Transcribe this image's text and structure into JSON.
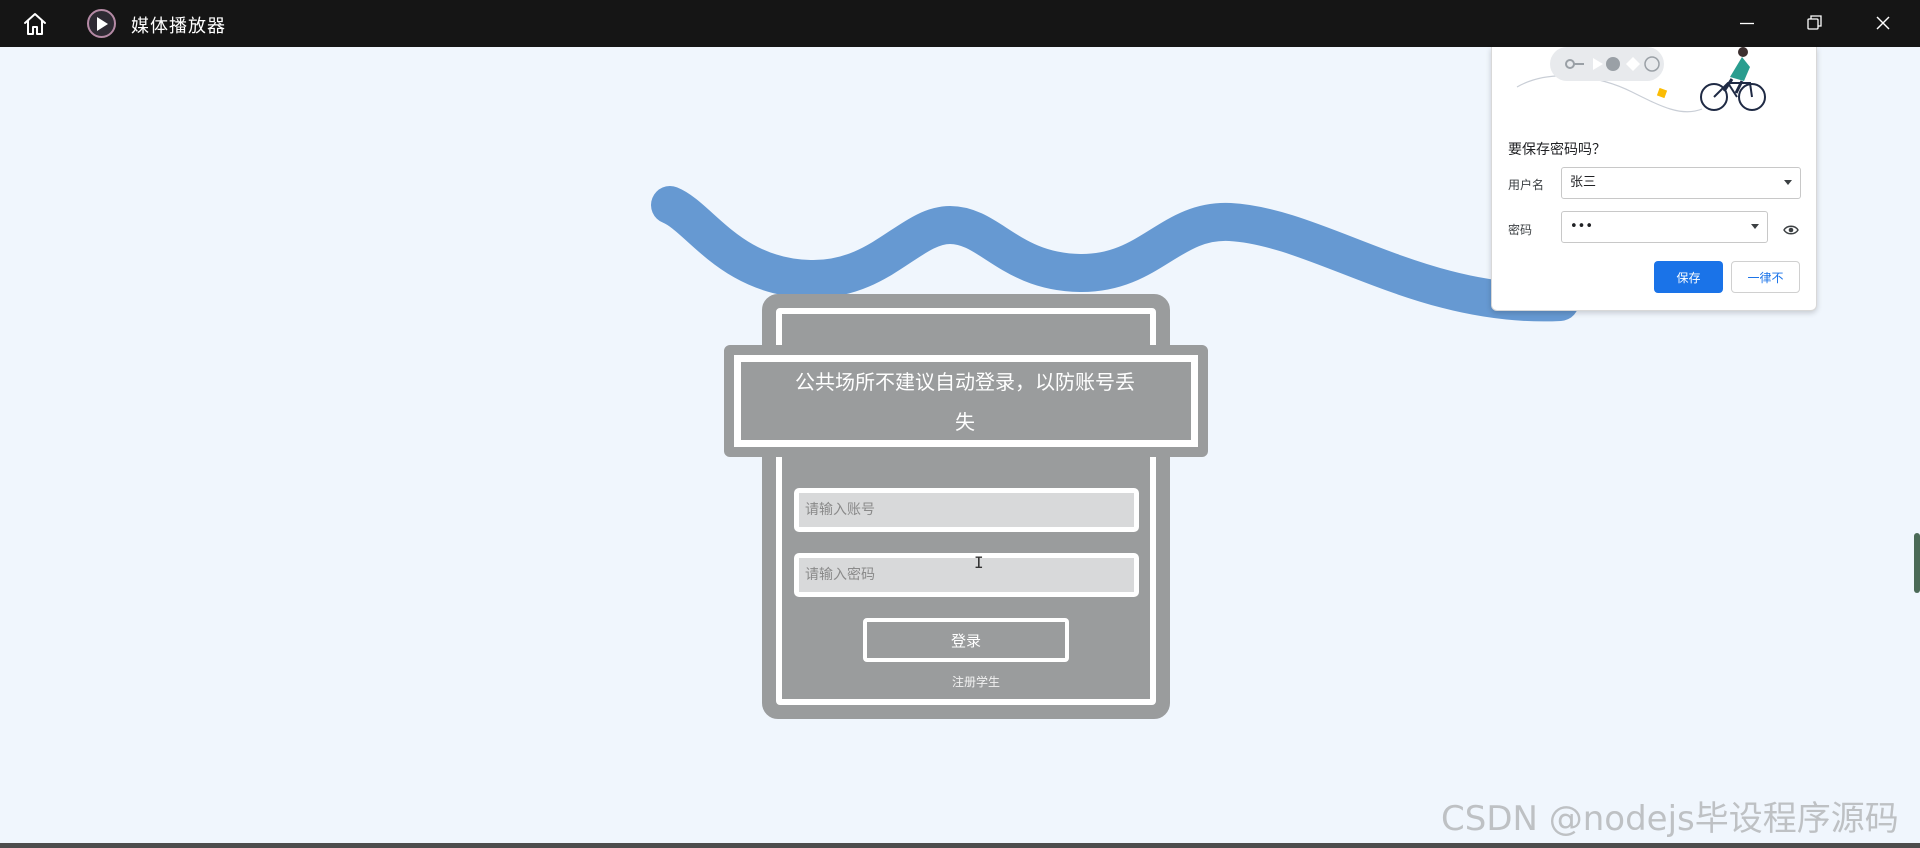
{
  "window": {
    "title": "媒体播放器"
  },
  "login": {
    "notice": "公共场所不建议自动登录，以防账号丢失",
    "account_placeholder": "请输入账号",
    "password_placeholder": "请输入密码",
    "login_label": "登录",
    "register_label": "注册学生"
  },
  "save_password_popup": {
    "title": "要保存密码吗？",
    "username_label": "用户名",
    "username_value": "张三",
    "password_label": "密码",
    "password_value": "•••",
    "save_label": "保存",
    "never_label": "一律不"
  },
  "watermark": "CSDN @nodejs毕设程序源码",
  "colors": {
    "titlebar": "#151515",
    "background": "#f0f6fd",
    "wave": "#6699d2",
    "card": "#9a9c9d",
    "primary_button": "#1a73e8"
  }
}
